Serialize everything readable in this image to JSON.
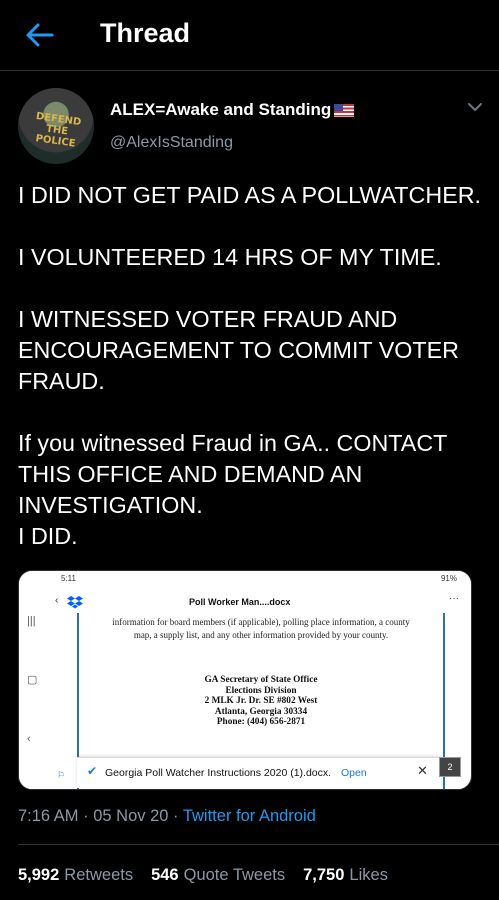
{
  "header": {
    "title": "Thread",
    "back_icon": "arrow-left-icon"
  },
  "author": {
    "name": "ALEX=Awake and Standing",
    "handle": "@AlexIsStanding",
    "avatar_text": "DEFEND THE POLICE",
    "flag_icon": "us-flag-emoji"
  },
  "tweet": {
    "paragraphs": [
      "I DID NOT GET PAID AS A POLLWATCHER.",
      "I VOLUNTEERED 14 HRS OF MY TIME.",
      "I WITNESSED VOTER FRAUD AND ENCOURAGEMENT TO COMMIT VOTER FRAUD.",
      "If you witnessed Fraud in GA.. CONTACT THIS OFFICE AND DEMAND AN INVESTIGATION."
    ],
    "closing": "I DID."
  },
  "media": {
    "status_time": "5:11",
    "status_right": "91%",
    "doc_title": "Poll Worker Man....docx",
    "page_line1": "information for board members (if applicable), polling place information, a county",
    "page_line2": "map, a supply list, and any other information provided by your county.",
    "address": {
      "line1": "GA Secretary of State Office",
      "line2": "Elections Division",
      "line3": "2 MLK Jr. Dr. SE #802 West",
      "line4": "Atlanta, Georgia 30334",
      "line5": "Phone: (404) 656-2871"
    },
    "download_text": "Georgia Poll Watcher Instructions 2020 (1).docx.",
    "download_action": "Open",
    "badge": "2"
  },
  "meta": {
    "time": "7:16 AM",
    "sep": "·",
    "date": "05 Nov 20",
    "source": "Twitter for Android"
  },
  "stats": {
    "retweets_count": "5,992",
    "retweets_label": "Retweets",
    "quotes_count": "546",
    "quotes_label": "Quote Tweets",
    "likes_count": "7,750",
    "likes_label": "Likes"
  },
  "colors": {
    "background": "#000000",
    "accent": "#1d9bf0",
    "secondary_text": "#8b98a5"
  }
}
